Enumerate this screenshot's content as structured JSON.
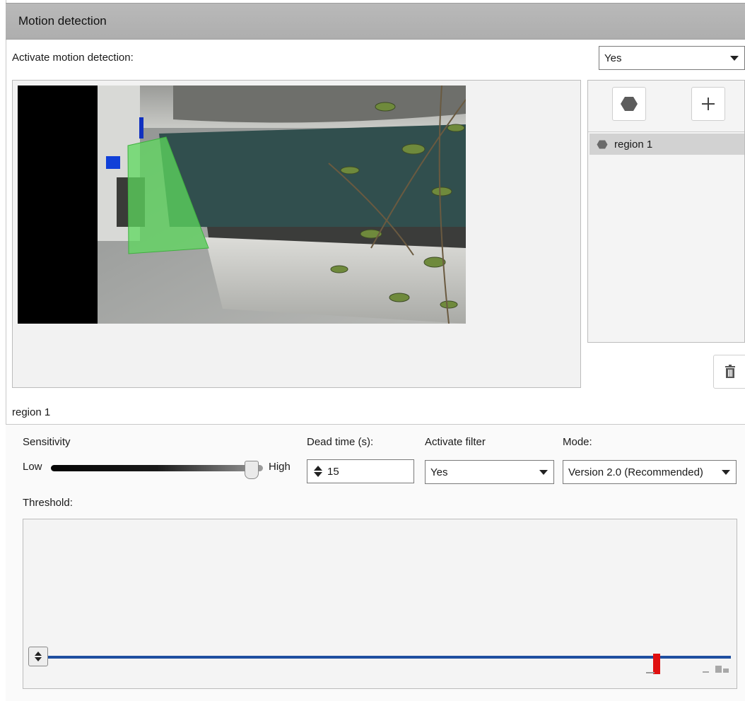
{
  "header": {
    "title": "Motion detection"
  },
  "activation": {
    "label": "Activate motion detection:",
    "value": "Yes"
  },
  "region_panel": {
    "regions": [
      {
        "label": "region 1"
      }
    ]
  },
  "selected_region": {
    "title": "region 1",
    "sensitivity": {
      "label": "Sensitivity",
      "low_label": "Low",
      "high_label": "High",
      "level": 0.95
    },
    "dead_time": {
      "label": "Dead time (s):",
      "value": "15"
    },
    "filter": {
      "label": "Activate filter",
      "value": "Yes"
    },
    "mode": {
      "label": "Mode:",
      "value": "Version 2.0 (Recommended)"
    },
    "threshold": {
      "label": "Threshold:"
    }
  },
  "colors": {
    "header_bg": "#b4b4b4",
    "region_overlay": "#5ed85e",
    "threshold_line": "#1f4fa0",
    "motion_level": "#e01010"
  },
  "icons": {
    "shape_tool": "hexagon-icon",
    "add": "plus-icon",
    "delete": "trash-icon",
    "spinner": "spinner-arrows-icon"
  }
}
